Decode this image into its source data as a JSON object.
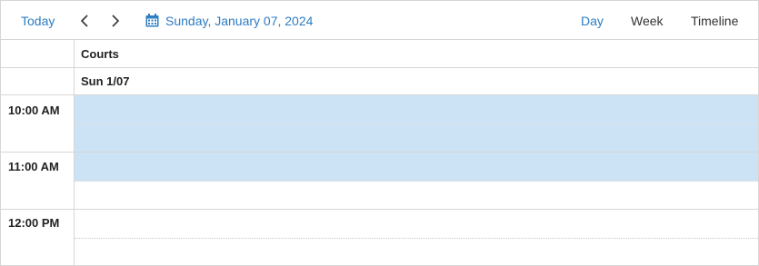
{
  "toolbar": {
    "today_label": "Today",
    "prev_icon": "chevron-left-icon",
    "next_icon": "chevron-right-icon",
    "calendar_icon": "calendar-icon",
    "current_date": "Sunday, January 07, 2024",
    "views": [
      "Day",
      "Week",
      "Timeline"
    ],
    "active_view": "Day"
  },
  "header": {
    "group_label": "Courts",
    "date_label": "Sun 1/07"
  },
  "time_slots": [
    "10:00 AM",
    "11:00 AM",
    "12:00 PM"
  ],
  "colors": {
    "accent": "#2e7cc2",
    "selection": "#cce3f6",
    "border": "#d6d6d6"
  }
}
